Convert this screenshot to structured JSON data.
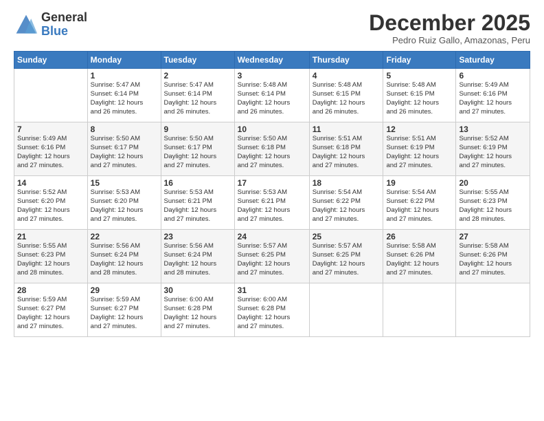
{
  "logo": {
    "general": "General",
    "blue": "Blue"
  },
  "title": "December 2025",
  "subtitle": "Pedro Ruiz Gallo, Amazonas, Peru",
  "days_header": [
    "Sunday",
    "Monday",
    "Tuesday",
    "Wednesday",
    "Thursday",
    "Friday",
    "Saturday"
  ],
  "weeks": [
    [
      {
        "num": "",
        "info": ""
      },
      {
        "num": "1",
        "info": "Sunrise: 5:47 AM\nSunset: 6:14 PM\nDaylight: 12 hours\nand 26 minutes."
      },
      {
        "num": "2",
        "info": "Sunrise: 5:47 AM\nSunset: 6:14 PM\nDaylight: 12 hours\nand 26 minutes."
      },
      {
        "num": "3",
        "info": "Sunrise: 5:48 AM\nSunset: 6:14 PM\nDaylight: 12 hours\nand 26 minutes."
      },
      {
        "num": "4",
        "info": "Sunrise: 5:48 AM\nSunset: 6:15 PM\nDaylight: 12 hours\nand 26 minutes."
      },
      {
        "num": "5",
        "info": "Sunrise: 5:48 AM\nSunset: 6:15 PM\nDaylight: 12 hours\nand 26 minutes."
      },
      {
        "num": "6",
        "info": "Sunrise: 5:49 AM\nSunset: 6:16 PM\nDaylight: 12 hours\nand 27 minutes."
      }
    ],
    [
      {
        "num": "7",
        "info": "Sunrise: 5:49 AM\nSunset: 6:16 PM\nDaylight: 12 hours\nand 27 minutes."
      },
      {
        "num": "8",
        "info": "Sunrise: 5:50 AM\nSunset: 6:17 PM\nDaylight: 12 hours\nand 27 minutes."
      },
      {
        "num": "9",
        "info": "Sunrise: 5:50 AM\nSunset: 6:17 PM\nDaylight: 12 hours\nand 27 minutes."
      },
      {
        "num": "10",
        "info": "Sunrise: 5:50 AM\nSunset: 6:18 PM\nDaylight: 12 hours\nand 27 minutes."
      },
      {
        "num": "11",
        "info": "Sunrise: 5:51 AM\nSunset: 6:18 PM\nDaylight: 12 hours\nand 27 minutes."
      },
      {
        "num": "12",
        "info": "Sunrise: 5:51 AM\nSunset: 6:19 PM\nDaylight: 12 hours\nand 27 minutes."
      },
      {
        "num": "13",
        "info": "Sunrise: 5:52 AM\nSunset: 6:19 PM\nDaylight: 12 hours\nand 27 minutes."
      }
    ],
    [
      {
        "num": "14",
        "info": "Sunrise: 5:52 AM\nSunset: 6:20 PM\nDaylight: 12 hours\nand 27 minutes."
      },
      {
        "num": "15",
        "info": "Sunrise: 5:53 AM\nSunset: 6:20 PM\nDaylight: 12 hours\nand 27 minutes."
      },
      {
        "num": "16",
        "info": "Sunrise: 5:53 AM\nSunset: 6:21 PM\nDaylight: 12 hours\nand 27 minutes."
      },
      {
        "num": "17",
        "info": "Sunrise: 5:53 AM\nSunset: 6:21 PM\nDaylight: 12 hours\nand 27 minutes."
      },
      {
        "num": "18",
        "info": "Sunrise: 5:54 AM\nSunset: 6:22 PM\nDaylight: 12 hours\nand 27 minutes."
      },
      {
        "num": "19",
        "info": "Sunrise: 5:54 AM\nSunset: 6:22 PM\nDaylight: 12 hours\nand 27 minutes."
      },
      {
        "num": "20",
        "info": "Sunrise: 5:55 AM\nSunset: 6:23 PM\nDaylight: 12 hours\nand 28 minutes."
      }
    ],
    [
      {
        "num": "21",
        "info": "Sunrise: 5:55 AM\nSunset: 6:23 PM\nDaylight: 12 hours\nand 28 minutes."
      },
      {
        "num": "22",
        "info": "Sunrise: 5:56 AM\nSunset: 6:24 PM\nDaylight: 12 hours\nand 28 minutes."
      },
      {
        "num": "23",
        "info": "Sunrise: 5:56 AM\nSunset: 6:24 PM\nDaylight: 12 hours\nand 28 minutes."
      },
      {
        "num": "24",
        "info": "Sunrise: 5:57 AM\nSunset: 6:25 PM\nDaylight: 12 hours\nand 27 minutes."
      },
      {
        "num": "25",
        "info": "Sunrise: 5:57 AM\nSunset: 6:25 PM\nDaylight: 12 hours\nand 27 minutes."
      },
      {
        "num": "26",
        "info": "Sunrise: 5:58 AM\nSunset: 6:26 PM\nDaylight: 12 hours\nand 27 minutes."
      },
      {
        "num": "27",
        "info": "Sunrise: 5:58 AM\nSunset: 6:26 PM\nDaylight: 12 hours\nand 27 minutes."
      }
    ],
    [
      {
        "num": "28",
        "info": "Sunrise: 5:59 AM\nSunset: 6:27 PM\nDaylight: 12 hours\nand 27 minutes."
      },
      {
        "num": "29",
        "info": "Sunrise: 5:59 AM\nSunset: 6:27 PM\nDaylight: 12 hours\nand 27 minutes."
      },
      {
        "num": "30",
        "info": "Sunrise: 6:00 AM\nSunset: 6:28 PM\nDaylight: 12 hours\nand 27 minutes."
      },
      {
        "num": "31",
        "info": "Sunrise: 6:00 AM\nSunset: 6:28 PM\nDaylight: 12 hours\nand 27 minutes."
      },
      {
        "num": "",
        "info": ""
      },
      {
        "num": "",
        "info": ""
      },
      {
        "num": "",
        "info": ""
      }
    ]
  ]
}
